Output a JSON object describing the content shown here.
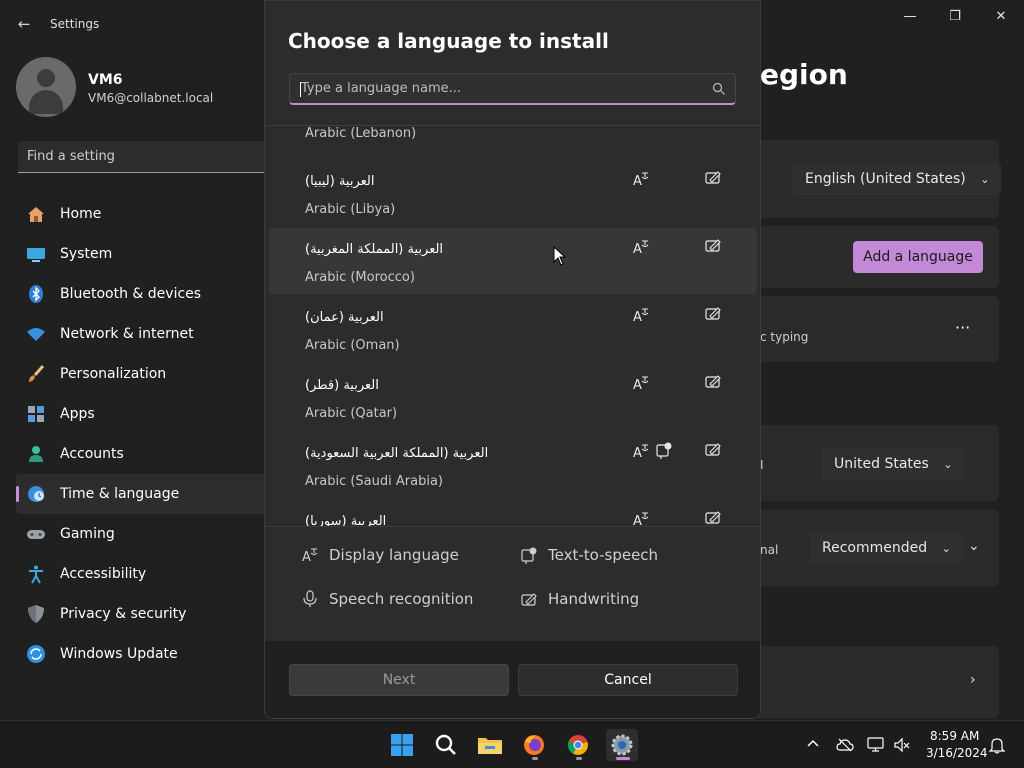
{
  "window": {
    "app_title": "Settings",
    "controls": {
      "minimize": "—",
      "maximize": "❐",
      "close": "✕"
    }
  },
  "profile": {
    "name": "VM6",
    "email": "VM6@collabnet.local"
  },
  "find_setting": {
    "placeholder": "Find a setting"
  },
  "sidebar": {
    "items": [
      {
        "label": "Home",
        "icon": "home-icon"
      },
      {
        "label": "System",
        "icon": "monitor-icon"
      },
      {
        "label": "Bluetooth & devices",
        "icon": "bluetooth-icon"
      },
      {
        "label": "Network & internet",
        "icon": "wifi-icon"
      },
      {
        "label": "Personalization",
        "icon": "paintbrush-icon"
      },
      {
        "label": "Apps",
        "icon": "apps-icon"
      },
      {
        "label": "Accounts",
        "icon": "person-icon"
      },
      {
        "label": "Time & language",
        "icon": "globe-clock-icon",
        "active": true
      },
      {
        "label": "Gaming",
        "icon": "gamepad-icon"
      },
      {
        "label": "Accessibility",
        "icon": "accessibility-icon"
      },
      {
        "label": "Privacy & security",
        "icon": "shield-icon"
      },
      {
        "label": "Windows Update",
        "icon": "update-icon"
      }
    ]
  },
  "main": {
    "title_fragment": "egion",
    "display_language_value": "English (United States)",
    "add_language_label": "Add a language",
    "typing_fragment": "c typing",
    "more_label": "···",
    "country_fragment": "I",
    "country_value": "United States",
    "regional_fragment": "nal",
    "regional_value": "Recommended"
  },
  "dialog": {
    "title": "Choose a language to install",
    "search_placeholder": "Type a language name...",
    "partial_top_item": "Arabic (Lebanon)",
    "languages": [
      {
        "native": "العربية (ليبيا)",
        "english": "Arabic (Libya)",
        "features": [
          "display-language",
          "handwriting"
        ]
      },
      {
        "native": "العربية (المملكة المغربية)",
        "english": "Arabic (Morocco)",
        "features": [
          "display-language",
          "handwriting"
        ],
        "hovered": true
      },
      {
        "native": "العربية (عمان)",
        "english": "Arabic (Oman)",
        "features": [
          "display-language",
          "handwriting"
        ]
      },
      {
        "native": "العربية (قطر)",
        "english": "Arabic (Qatar)",
        "features": [
          "display-language",
          "handwriting"
        ]
      },
      {
        "native": "العربية (المملكة العربية السعودية)",
        "english": "Arabic (Saudi Arabia)",
        "features": [
          "display-language",
          "text-to-speech",
          "handwriting"
        ]
      },
      {
        "native": "العربية (سوريا)",
        "english": "",
        "features": [
          "display-language",
          "handwriting"
        ]
      }
    ],
    "legend": {
      "display_language": "Display language",
      "text_to_speech": "Text-to-speech",
      "speech_recognition": "Speech recognition",
      "handwriting": "Handwriting"
    },
    "next_label": "Next",
    "cancel_label": "Cancel"
  },
  "taskbar": {
    "apps": [
      "windows-start-icon",
      "search-icon",
      "file-explorer-icon",
      "firefox-icon",
      "chrome-icon",
      "settings-gear-icon"
    ],
    "time": "8:59 AM",
    "date": "3/16/2024"
  },
  "colors": {
    "accent": "#c489d6",
    "background": "#202020",
    "dialog": "#2c2c2c"
  }
}
